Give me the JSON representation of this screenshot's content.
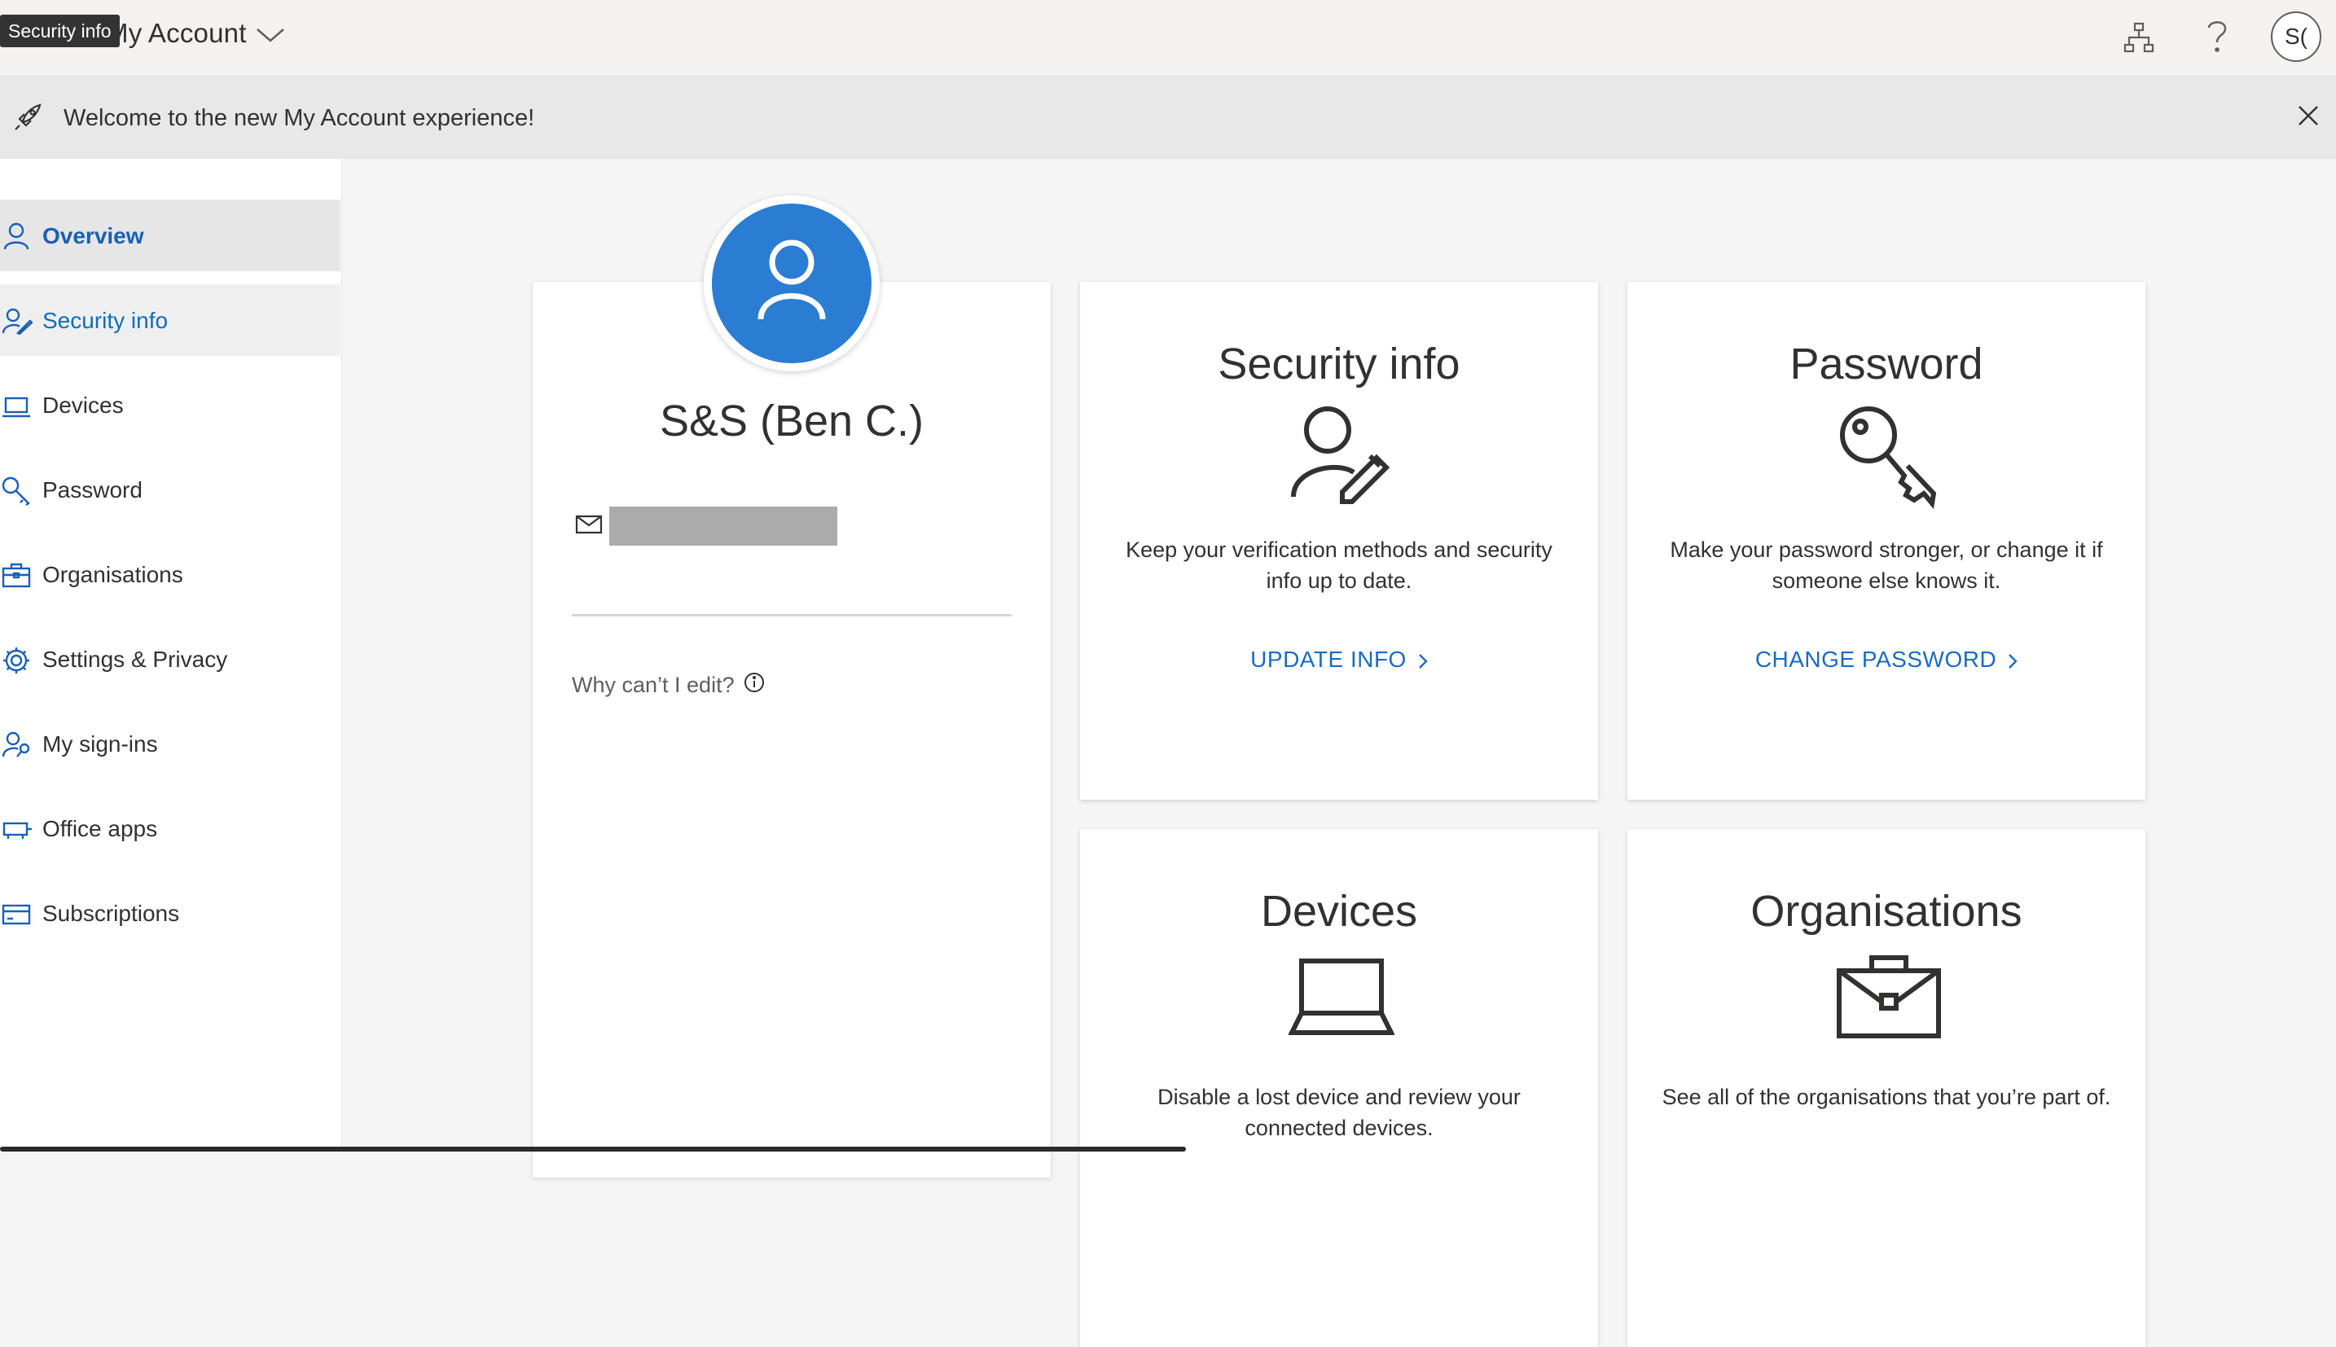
{
  "topbar": {
    "app_title": "My Account",
    "tooltip": "Security info",
    "avatar_initials": "S("
  },
  "banner": {
    "message": "Welcome to the new My Account experience!"
  },
  "sidebar": {
    "items": [
      {
        "label": "Overview",
        "icon": "person-icon"
      },
      {
        "label": "Security info",
        "icon": "person-edit-icon"
      },
      {
        "label": "Devices",
        "icon": "laptop-icon"
      },
      {
        "label": "Password",
        "icon": "key-icon"
      },
      {
        "label": "Organisations",
        "icon": "briefcase-icon"
      },
      {
        "label": "Settings & Privacy",
        "icon": "gear-icon"
      },
      {
        "label": "My sign-ins",
        "icon": "person-key-icon"
      },
      {
        "label": "Office apps",
        "icon": "office-apps-icon"
      },
      {
        "label": "Subscriptions",
        "icon": "card-icon"
      }
    ]
  },
  "profile": {
    "name": "S&S (Ben C.)",
    "why_edit": "Why can’t I edit?"
  },
  "tiles": {
    "security": {
      "title": "Security info",
      "description": "Keep your verification methods and security info up to date.",
      "link": "UPDATE INFO"
    },
    "password": {
      "title": "Password",
      "description": "Make your password stronger, or change it if someone else knows it.",
      "link": "CHANGE PASSWORD"
    },
    "devices": {
      "title": "Devices",
      "description": "Disable a lost device and review your connected devices."
    },
    "organisations": {
      "title": "Organisations",
      "description": "See all of the organisations that you’re part of."
    }
  },
  "colors": {
    "accent": "#1a6bc4",
    "avatar_blue": "#2b7cd3",
    "nav_active_bg": "#e6e6e6"
  }
}
